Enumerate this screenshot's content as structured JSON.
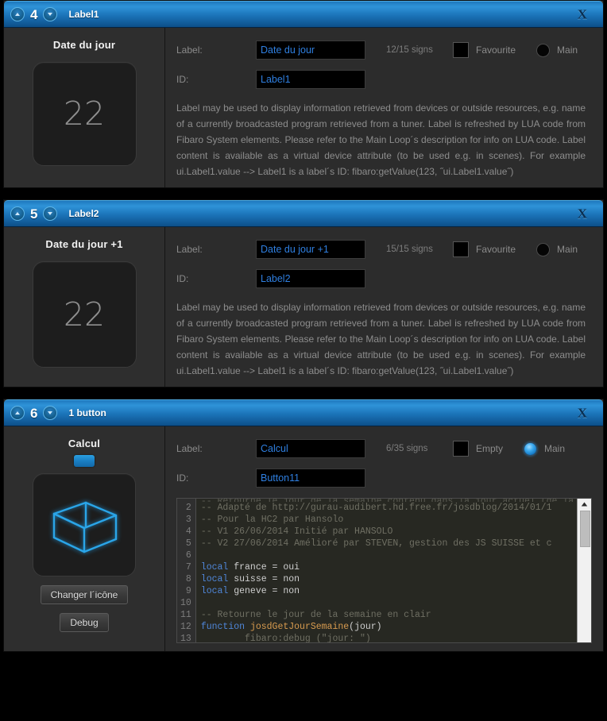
{
  "panels": [
    {
      "number": "4",
      "title": "Label1",
      "close_label": "X",
      "preview": {
        "title": "Date du jour",
        "value": "22"
      },
      "form": {
        "label_caption": "Label:",
        "label_value": "Date du jour",
        "id_caption": "ID:",
        "id_value": "Label1",
        "signs": "12/15 signs",
        "checkbox_label": "Favourite",
        "checkbox_checked": false,
        "radio_label": "Main",
        "radio_selected": false
      },
      "description": "Label may be used to display information retrieved from devices or outside resources, e.g. name of a currently broadcasted program retrieved from a tuner. Label is refreshed by LUA code from Fibaro System elements. Please refer to the Main Loop´s description for info on LUA code. Label content is available as a virtual device attribute (to be used e.g. in scenes). For example ui.Label1.value --> Label1 is a label´s ID: fibaro:getValue(123, ˝ui.Label1.value˝)"
    },
    {
      "number": "5",
      "title": "Label2",
      "close_label": "X",
      "preview": {
        "title": "Date du jour +1",
        "value": "22"
      },
      "form": {
        "label_caption": "Label:",
        "label_value": "Date du jour +1",
        "id_caption": "ID:",
        "id_value": "Label2",
        "signs": "15/15 signs",
        "checkbox_label": "Favourite",
        "checkbox_checked": false,
        "radio_label": "Main",
        "radio_selected": false
      },
      "description": "Label may be used to display information retrieved from devices or outside resources, e.g. name of a currently broadcasted program retrieved from a tuner. Label is refreshed by LUA code from Fibaro System elements. Please refer to the Main Loop´s description for info on LUA code. Label content is available as a virtual device attribute (to be used e.g. in scenes). For example ui.Label1.value --> Label1 is a label´s ID: fibaro:getValue(123, ˝ui.Label1.value˝)"
    },
    {
      "number": "6",
      "title": "1 button",
      "close_label": "X",
      "preview": {
        "title": "Calcul",
        "icon": "wireframe-cube-icon",
        "change_icon_label": "Changer l´icône",
        "debug_label": "Debug"
      },
      "form": {
        "label_caption": "Label:",
        "label_value": "Calcul",
        "id_caption": "ID:",
        "id_value": "Button11",
        "signs": "6/35 signs",
        "checkbox_label": "Empty",
        "checkbox_checked": false,
        "radio_label": "Main",
        "radio_selected": true
      },
      "code": {
        "line_numbers": [
          "2",
          "3",
          "4",
          "5",
          "6",
          "7",
          "8",
          "9",
          "10",
          "11",
          "12",
          "13"
        ],
        "lines": [
          "-- Adapté de http://gurau-audibert.hd.free.fr/josdblog/2014/01/1",
          "-- Pour la HC2 par Hansolo",
          "-- V1 26/06/2014 Initié par HANSOLO",
          "-- V2 27/06/2014 Amélioré par STEVEN, gestion des JS SUISSE et c",
          "",
          "local france = oui",
          "local suisse = non",
          "local geneve = non",
          "",
          "-- Retourne le jour de la semaine en clair",
          "function josdGetJourSemaine(jour)",
          "        fibaro:debug (\"jour: \")"
        ],
        "partial_top_line": "-- Retourne le jour de la semaine contenu dans la jour actuel (de la date)"
      }
    }
  ],
  "colors": {
    "header_blue": "#1e78bd",
    "input_text_blue": "#2f7fe0",
    "accent_blue": "#2a9fe0",
    "panel_bg": "#2c2c2c",
    "page_bg": "#000000"
  }
}
